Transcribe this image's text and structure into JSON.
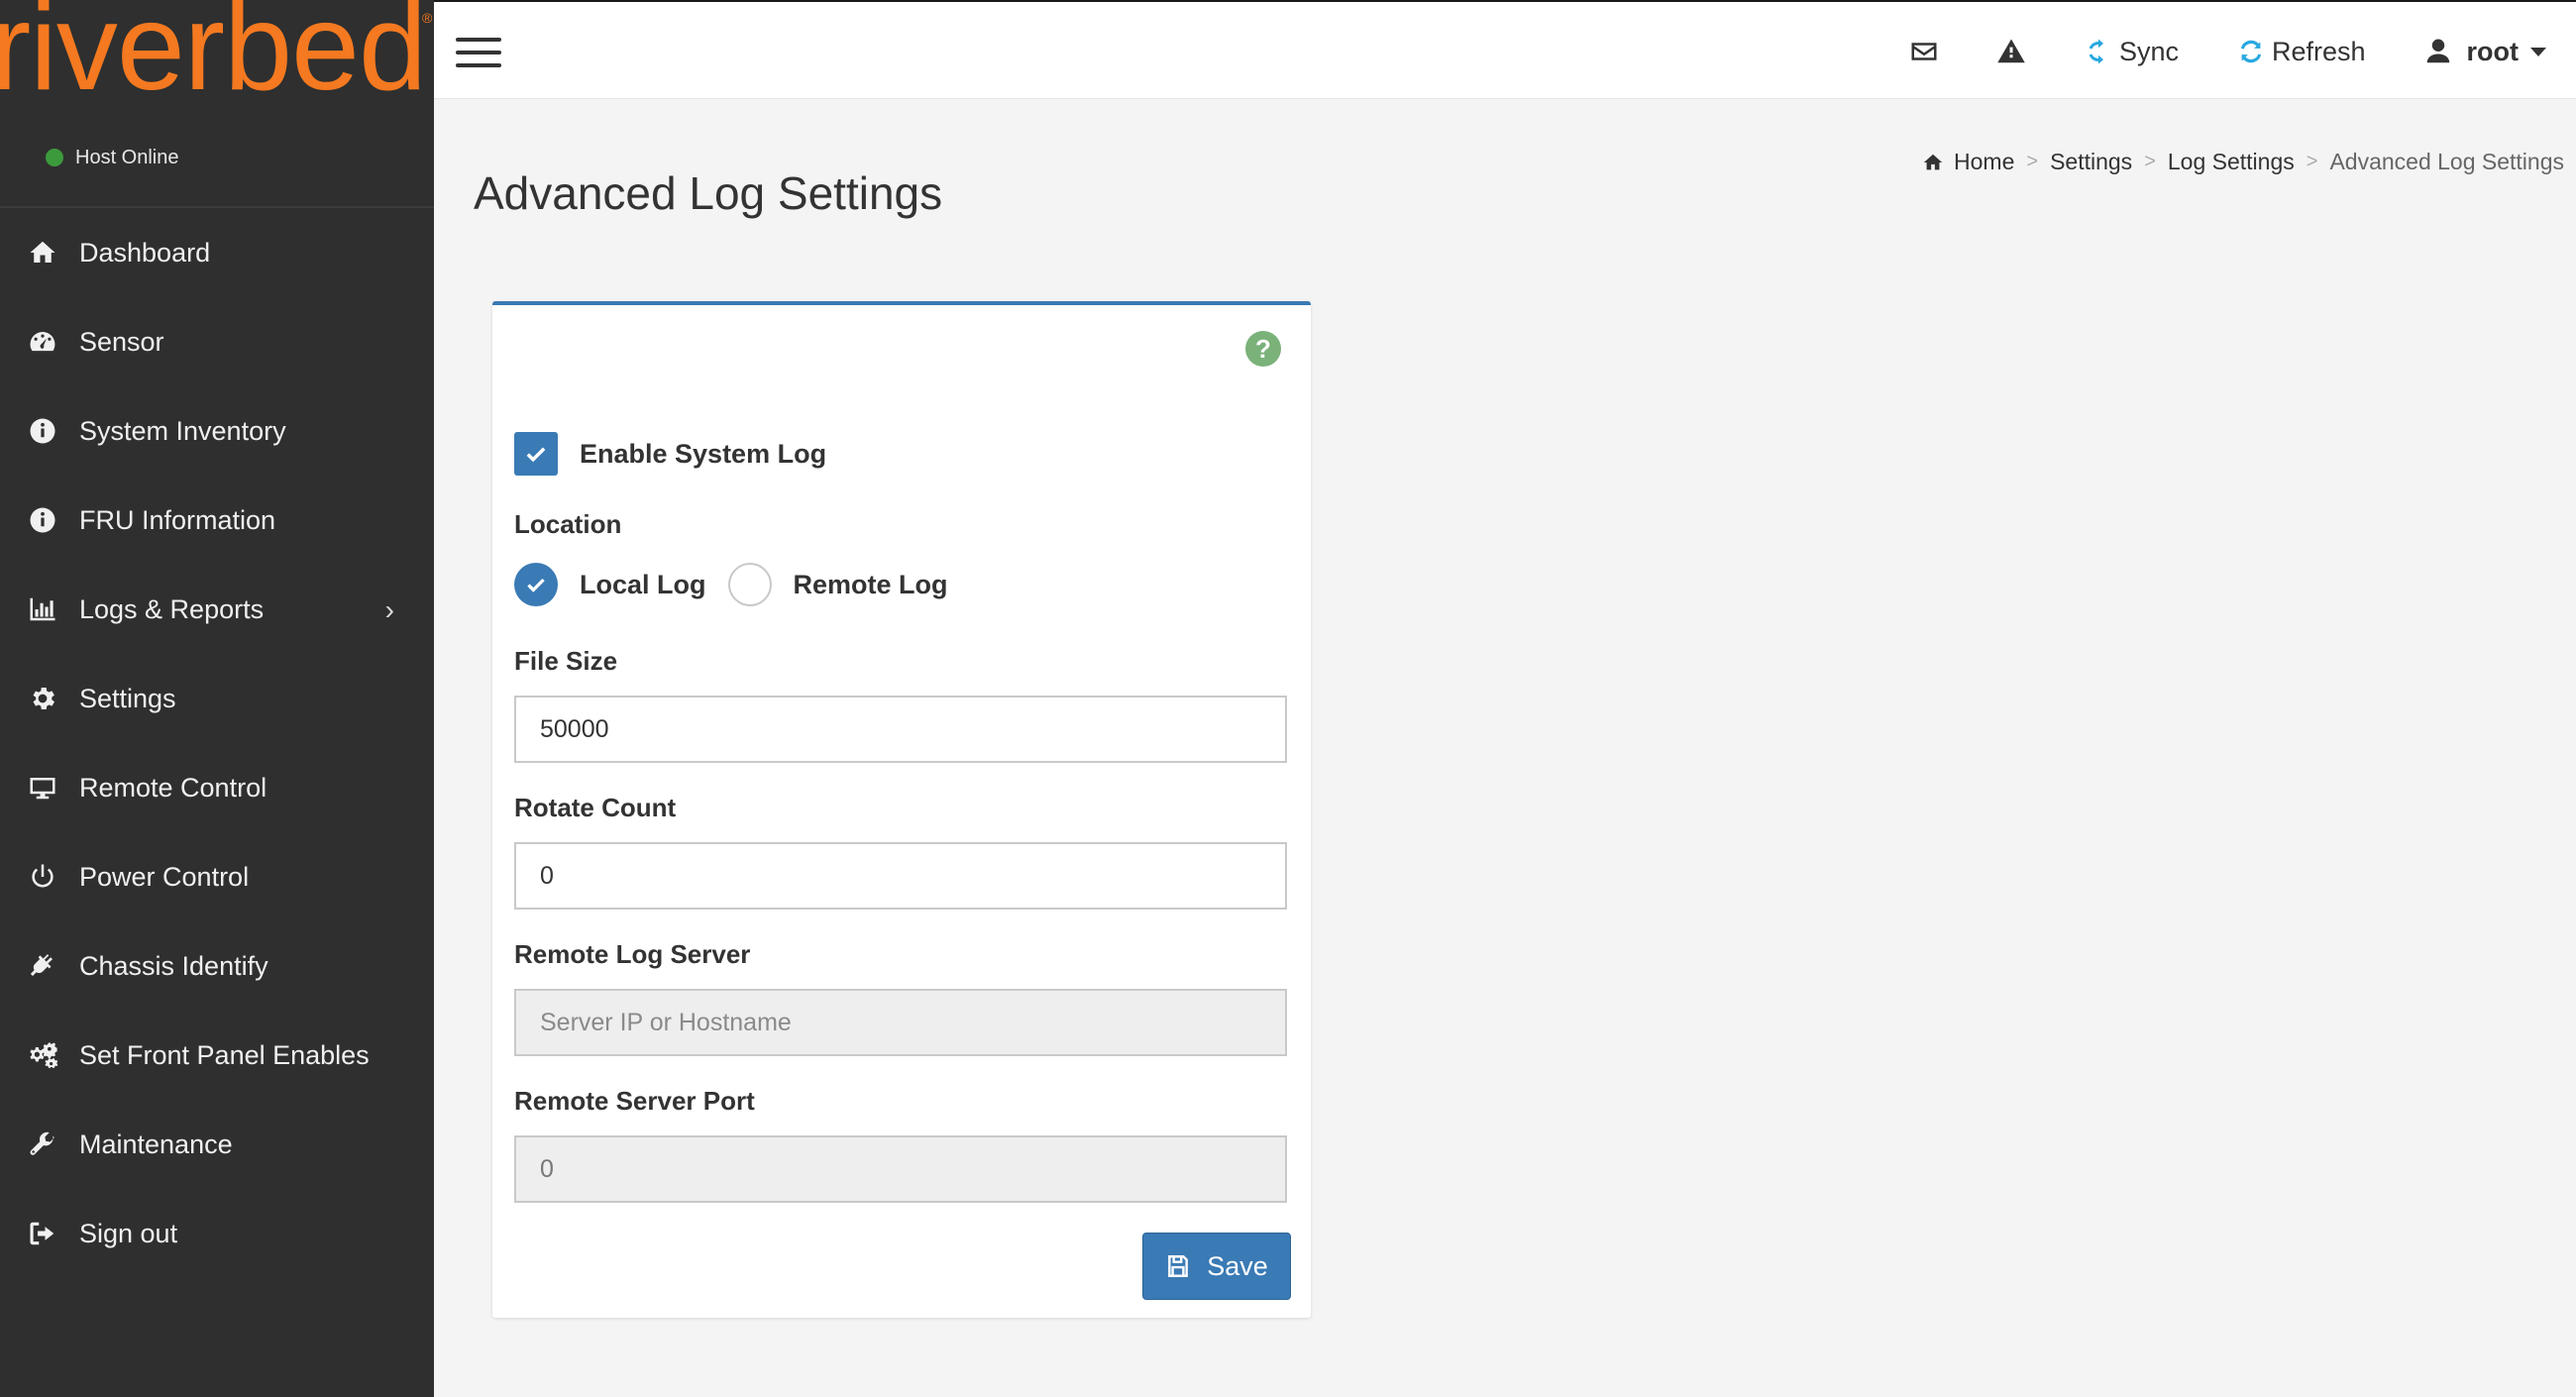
{
  "brand": {
    "logo_text": "riverbed",
    "reg_mark": "®"
  },
  "host": {
    "status": "Host Online",
    "status_color": "#3c9a3c"
  },
  "sidebar": {
    "items": [
      {
        "label": "Dashboard",
        "icon": "home-icon"
      },
      {
        "label": "Sensor",
        "icon": "dashboard-gauge-icon"
      },
      {
        "label": "System Inventory",
        "icon": "info-circle-icon"
      },
      {
        "label": "FRU Information",
        "icon": "info-circle-icon"
      },
      {
        "label": "Logs & Reports",
        "icon": "bar-chart-icon",
        "has_submenu": true
      },
      {
        "label": "Settings",
        "icon": "gear-icon"
      },
      {
        "label": "Remote Control",
        "icon": "monitor-icon"
      },
      {
        "label": "Power Control",
        "icon": "power-icon"
      },
      {
        "label": "Chassis Identify",
        "icon": "plug-icon"
      },
      {
        "label": "Set Front Panel Enables",
        "icon": "gears-icon"
      },
      {
        "label": "Maintenance",
        "icon": "wrench-icon"
      },
      {
        "label": "Sign out",
        "icon": "sign-out-icon"
      }
    ]
  },
  "topbar": {
    "sync_label": "Sync",
    "refresh_label": "Refresh",
    "user_label": "root",
    "accent_color": "#29a8e0"
  },
  "page": {
    "title": "Advanced Log Settings"
  },
  "breadcrumb": {
    "home": "Home",
    "settings": "Settings",
    "log_settings": "Log Settings",
    "current": "Advanced Log Settings",
    "separator": ">"
  },
  "form": {
    "help_glyph": "?",
    "enable_system_log_label": "Enable System Log",
    "enable_system_log_checked": true,
    "location_label": "Location",
    "local_log_label": "Local Log",
    "remote_log_label": "Remote Log",
    "location_selected": "Local Log",
    "file_size_label": "File Size",
    "file_size_value": "50000",
    "rotate_count_label": "Rotate Count",
    "rotate_count_value": "0",
    "remote_log_server_label": "Remote Log Server",
    "remote_log_server_placeholder": "Server IP or Hostname",
    "remote_log_server_value": "",
    "remote_server_port_label": "Remote Server Port",
    "remote_server_port_value": "0",
    "save_label": "Save"
  },
  "colors": {
    "primary": "#3a7ab5",
    "logo": "#f47920",
    "sidebar_bg": "#2f2f2f"
  }
}
